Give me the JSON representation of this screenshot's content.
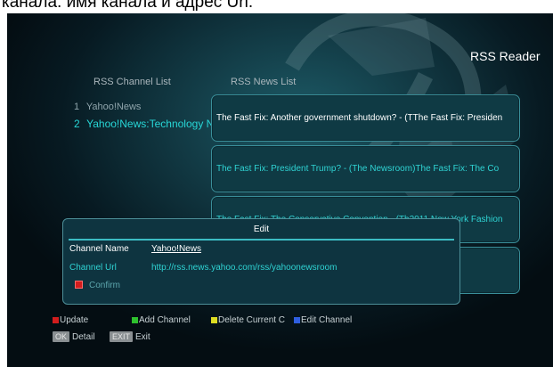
{
  "caption": "канала: имя канала и адрес Url.",
  "screen": {
    "title": "RSS Reader",
    "channel_list": {
      "header": "RSS Channel List",
      "items": [
        {
          "num": "1",
          "label": "Yahoo!News"
        },
        {
          "num": "2",
          "label": "Yahoo!News:Technology N"
        }
      ]
    },
    "news_list": {
      "header": "RSS News List",
      "items": [
        {
          "text": "The Fast Fix: Another government shutdown? -   (TThe Fast Fix: Presiden"
        },
        {
          "text": "The Fast Fix: President Trump? -   (The Newsroom)The Fast Fix: The Co"
        },
        {
          "text": "The Fast Fix: The Conservative Convention -   (Th2011 New York Fashion"
        },
        {
          "text": ""
        }
      ]
    },
    "edit_dialog": {
      "title": "Edit",
      "name_label": "Channel Name",
      "name_value": "Yahoo!News",
      "url_label": "Channel Url",
      "url_value": "http://rss.news.yahoo.com/rss/yahoonewsroom",
      "confirm_label": "Confirm"
    },
    "legend": {
      "update": "Update",
      "add_channel": "Add Channel",
      "delete_channel": "Delete Current C",
      "edit_channel": "Edit Channel",
      "ok_key": "OK",
      "detail": "Detail",
      "exit_key": "EXIT",
      "exit": "Exit"
    },
    "colors": {
      "red": "#d21d1d",
      "green": "#2ec12e",
      "yellow": "#dddd22",
      "blue": "#2f5fe0",
      "accent_cyan": "#2fd3d3"
    }
  }
}
